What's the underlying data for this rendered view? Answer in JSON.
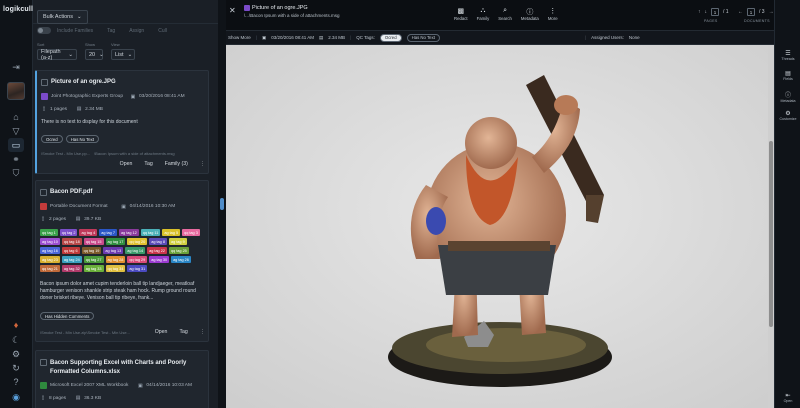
{
  "app": {
    "logo": "logikcull"
  },
  "rail_icons": [
    "collapse-icon",
    "home-icon",
    "filter-icon",
    "documents-icon",
    "share-icon",
    "shield-icon"
  ],
  "rail_bottom_icons": [
    "notification-icon",
    "moon-icon",
    "settings-icon",
    "history-icon",
    "help-icon",
    "logout-icon"
  ],
  "topbar": {
    "bulk_actions": "Bulk Actions"
  },
  "toolbar2": {
    "include_families": "Include Families",
    "tag": "Tag",
    "assign": "Assign",
    "cull": "Cull"
  },
  "controls": {
    "sort": {
      "label": "Sort",
      "value": "Filepath (a-z)"
    },
    "show": {
      "label": "Show",
      "value": "20"
    },
    "view": {
      "label": "View",
      "value": "List"
    }
  },
  "cards": [
    {
      "title": "Picture of an ogre.JPG",
      "format": "Joint Photographic Experts Group",
      "date": "03/20/2016 08:41 AM",
      "pages": "1 pages",
      "size": "2.34 MB",
      "text": "There is no text to display for this document",
      "chips": [
        "Ocred",
        "Has No Text"
      ],
      "source": "\\Smoke Test - Min Use.pp...",
      "family_note": "\\Bacon Ipsum with a side of attachments.msg",
      "open": "Open",
      "tag": "Tag",
      "family": "Family (3)"
    },
    {
      "title": "Bacon PDF.pdf",
      "format": "Portable Document Format",
      "date": "04/14/2016 10:30 AM",
      "pages": "2 pages",
      "size": "39.7 KB",
      "tags": [
        {
          "label": "qq tag 1",
          "color": "#3aa14a"
        },
        {
          "label": "qq tag 2",
          "color": "#7a4fc9"
        },
        {
          "label": "ag tag 4",
          "color": "#c0395a"
        },
        {
          "label": "ag tag 7",
          "color": "#2a56c6"
        },
        {
          "label": "ag tag 12",
          "color": "#8a3a9c"
        },
        {
          "label": "qq tag 11",
          "color": "#4bb0b8"
        },
        {
          "label": "ag tag 5",
          "color": "#d9c02a"
        },
        {
          "label": "qq tag 3",
          "color": "#e86aa0"
        },
        {
          "label": "ag tag 10",
          "color": "#9c4fd0"
        },
        {
          "label": "qq tag 18",
          "color": "#b84848"
        },
        {
          "label": "qq tag 15",
          "color": "#c84a8a"
        },
        {
          "label": "ag tag 17",
          "color": "#2f8f3e"
        },
        {
          "label": "qq tag 20",
          "color": "#e0c030"
        },
        {
          "label": "ag tag 8",
          "color": "#5a4ab8"
        },
        {
          "label": "ag tag 9",
          "color": "#d0d040"
        },
        {
          "label": "ag tag 16",
          "color": "#4a66d8"
        },
        {
          "label": "qq tag 6",
          "color": "#c03a3a"
        },
        {
          "label": "qq tag 19",
          "color": "#7d5a2a"
        },
        {
          "label": "ag tag 13",
          "color": "#6a3ab0"
        },
        {
          "label": "ag tag 14",
          "color": "#3a9a6a"
        },
        {
          "label": "ag tag 22",
          "color": "#c8344a"
        },
        {
          "label": "qq tag 25",
          "color": "#6aa03a"
        },
        {
          "label": "ag tag 23",
          "color": "#d8b030"
        },
        {
          "label": "ag tag 24",
          "color": "#3aa0c0"
        },
        {
          "label": "qq tag 27",
          "color": "#4a9a3a"
        },
        {
          "label": "ag tag 28",
          "color": "#e09030"
        },
        {
          "label": "qq tag 29",
          "color": "#d84a78"
        },
        {
          "label": "ag tag 30",
          "color": "#9a3ad0"
        },
        {
          "label": "ag tag 26",
          "color": "#2a86c6"
        },
        {
          "label": "qq tag 21",
          "color": "#c06a3a"
        },
        {
          "label": "ag tag 32",
          "color": "#b03a6a"
        },
        {
          "label": "ag tag 33",
          "color": "#6ab03a"
        },
        {
          "label": "qq tag 34",
          "color": "#e0c040"
        },
        {
          "label": "ag tag 31",
          "color": "#4a4ac0"
        }
      ],
      "text": "Bacon ipsum dolor amet cupim tenderloin ball tip landjaeger, meatloaf hamburger venison shankle strip steak ham hock. Rump ground round doner brisket ribeye. Venison ball tip ribeye, frank...",
      "chips": [
        "Has Hidden Comments"
      ],
      "source": "\\Smoke Test - Min Use.zip\\Smoke Test - Min Use...",
      "open": "Open",
      "tag": "Tag"
    },
    {
      "title": "Bacon Supporting Excel with Charts and Poorly Formatted Columns.xlsx",
      "format": "Microsoft Excel 2007 XML Workbook",
      "date": "04/14/2016 10:03 AM",
      "pages": "8 pages",
      "size": "36.3 KB"
    }
  ],
  "viewer": {
    "title": "Picture of an ogre.JPG",
    "subtitle": "\\...\\Bacon Ipsum with a side of attachments.msg",
    "tools": [
      {
        "label": "Redact",
        "icon": "redact-icon"
      },
      {
        "label": "Family",
        "icon": "family-icon"
      },
      {
        "label": "Search",
        "icon": "search-icon"
      },
      {
        "label": "Metadata",
        "icon": "info-icon"
      },
      {
        "label": "More",
        "icon": "more-icon"
      }
    ],
    "pages": {
      "current": "1",
      "total": "/ 1",
      "label": "PAGES"
    },
    "documents": {
      "current": "1",
      "total": "/ 3",
      "label": "DOCUMENTS"
    },
    "infobar": {
      "show_more": "Show More",
      "date": "03/20/2016 08:41 AM",
      "size": "2.34 MB",
      "qc_tags_label": "QC Tags:",
      "qc_tags": [
        "Ocred",
        "Has No Text"
      ],
      "assigned_label": "Assigned Users:",
      "assigned_value": "None"
    }
  },
  "right_tools": [
    {
      "label": "Threads",
      "icon": "threads-icon"
    },
    {
      "label": "Fields",
      "icon": "fields-icon"
    },
    {
      "label": "Metadata",
      "icon": "metadata-icon"
    },
    {
      "label": "Customize",
      "icon": "customize-icon"
    }
  ],
  "right_bottom": {
    "label": "Open",
    "icon": "open-icon"
  },
  "colors": {
    "accent": "#53a3e0",
    "sidebar_bg": "#1a1f26",
    "viewer_bg": "#dcdcdc"
  }
}
